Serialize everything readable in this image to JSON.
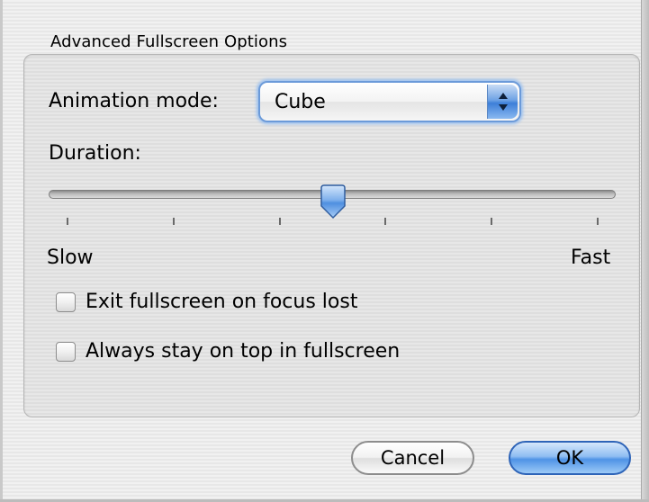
{
  "dialog": {
    "group_title": "Advanced Fullscreen Options",
    "animation": {
      "label": "Animation mode:",
      "selected": "Cube"
    },
    "duration": {
      "label": "Duration:",
      "min_label": "Slow",
      "max_label": "Fast",
      "value_fraction": 0.5,
      "tick_count": 6
    },
    "checkboxes": [
      {
        "label": "Exit fullscreen on focus lost",
        "checked": false
      },
      {
        "label": "Always stay on top in fullscreen",
        "checked": false
      }
    ],
    "buttons": {
      "cancel": "Cancel",
      "ok": "OK"
    }
  },
  "colors": {
    "accent": "#4f93e6",
    "focus_ring": "#9cc1ef"
  }
}
